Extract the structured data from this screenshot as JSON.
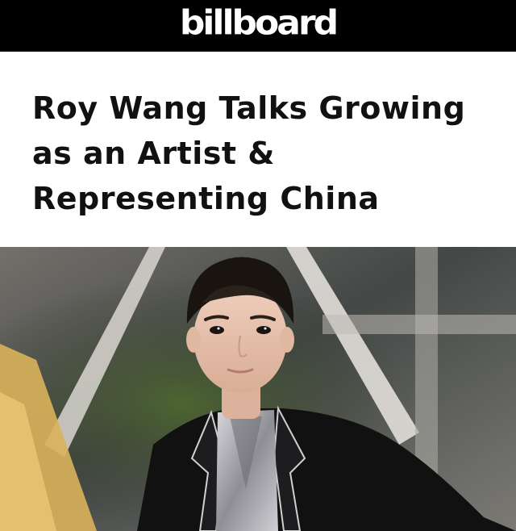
{
  "header": {
    "logo_text": "billboard"
  },
  "article": {
    "headline": "Roy Wang Talks Growing as an Artist & Representing China"
  },
  "photo": {
    "icon": "portrait-photo",
    "colors": {
      "background": "#5a5f5c",
      "suit": "#111111",
      "shirt": "#b9b9bd",
      "skin": "#e6c2ad",
      "hair": "#1a1410",
      "stage_light": "#d9d6d0",
      "yellow_panel": "#d9b25a"
    }
  }
}
